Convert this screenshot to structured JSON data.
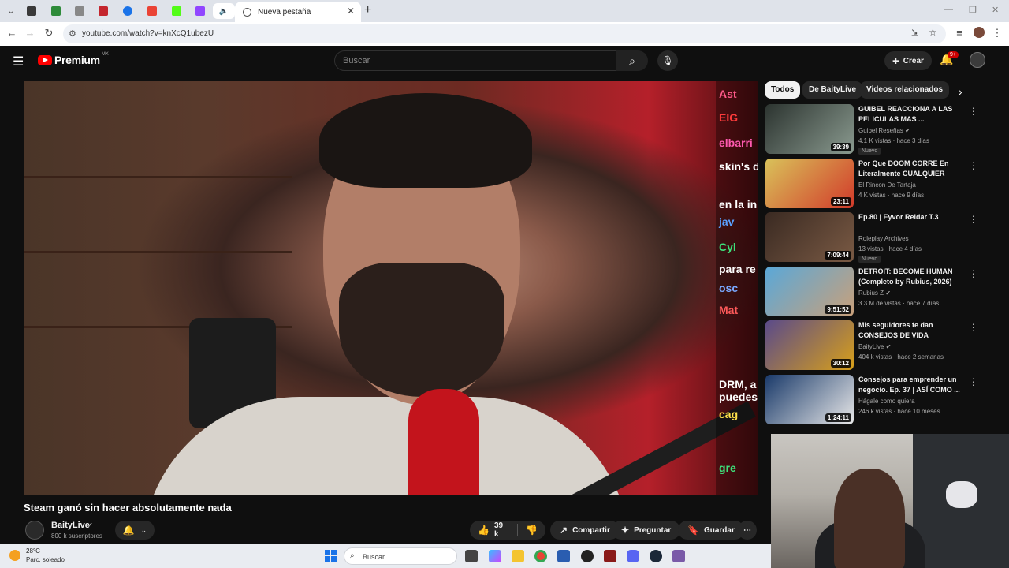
{
  "browser": {
    "tab_title": "Nueva pestaña",
    "url": "youtube.com/watch?v=knXcQ1ubezU"
  },
  "youtube": {
    "logo_text": "Premium",
    "country_code": "MX",
    "search_placeholder": "Buscar",
    "create_label": "Crear",
    "notifications_badge": "9+"
  },
  "video": {
    "title": "Steam ganó sin hacer absolutamente nada",
    "channel_name": "BaityLive",
    "subscribers": "800 k suscriptores",
    "like_count": "39 k",
    "share_label": "Compartir",
    "ask_label": "Preguntar",
    "save_label": "Guardar"
  },
  "chat_overlay": [
    {
      "text": "Ast",
      "color": "#ff5a8a"
    },
    {
      "text": "EIG",
      "color": "#ff3b3b"
    },
    {
      "text": "elbarri",
      "color": "#ff5ab0"
    },
    {
      "text": "skin's d",
      "color": "#ffffff"
    },
    {
      "text": "en la in",
      "color": "#ffffff"
    },
    {
      "text": "jav",
      "color": "#5aa0ff"
    },
    {
      "text": "Cyl",
      "color": "#3ee07a"
    },
    {
      "text": "para re",
      "color": "#ffffff"
    },
    {
      "text": "osc",
      "color": "#7aa8ff"
    },
    {
      "text": "Mat",
      "color": "#ff5a5a"
    },
    {
      "text": "DRM, a",
      "color": "#ffffff"
    },
    {
      "text": "puedes",
      "color": "#ffffff"
    },
    {
      "text": "cag",
      "color": "#ffe34a"
    },
    {
      "text": "gre",
      "color": "#3ee07a"
    }
  ],
  "sidebar": {
    "chips": [
      "Todos",
      "De BaityLive",
      "Videos relacionados"
    ],
    "recommendations": [
      {
        "title": "GUIBEL REACCIONA A LAS PELICULAS MAS ...",
        "channel": "Guibel Reseñas",
        "verified": true,
        "meta": "4.1 K vistas · hace 3 días",
        "duration": "39:39",
        "badge": "Nuevo",
        "thumb": [
          "#2c3430",
          "#8a9a8f"
        ]
      },
      {
        "title": "Por Que DOOM CORRE En Literalmente CUALQUIER COS...",
        "channel": "El Rincon De Tartaja",
        "verified": false,
        "meta": "4 K vistas · hace 9 días",
        "duration": "23:11",
        "badge": "",
        "thumb": [
          "#d9c25a",
          "#d23a2a"
        ]
      },
      {
        "title": "Ep.80 | Eyvor Reidar T.3",
        "channel": "Roleplay Archives",
        "verified": false,
        "meta": "13 vistas · hace 4 días",
        "duration": "7:09:44",
        "badge": "Nuevo",
        "thumb": [
          "#3a2a22",
          "#7a5a44"
        ]
      },
      {
        "title": "DETROIT: BECOME HUMAN (Completo by Rubius, 2026)",
        "channel": "Rubius Z",
        "verified": true,
        "meta": "3.3 M de vistas · hace 7 días",
        "duration": "9:51:52",
        "badge": "",
        "thumb": [
          "#5aa8d8",
          "#c9a07a"
        ]
      },
      {
        "title": "Mis seguidores te dan CONSEJOS DE VIDA",
        "channel": "BaityLive",
        "verified": true,
        "meta": "404 k vistas · hace 2 semanas",
        "duration": "30:12",
        "badge": "",
        "thumb": [
          "#5a4a8a",
          "#d8a01a"
        ]
      },
      {
        "title": "Consejos para emprender un negocio. Ep. 37 | ASÍ COMO ...",
        "channel": "Hágale como quiera",
        "verified": false,
        "meta": "246 k vistas · hace 10 meses",
        "duration": "1:24:11",
        "badge": "",
        "thumb": [
          "#1a3a6a",
          "#e8e8e8"
        ]
      }
    ]
  },
  "taskbar": {
    "temp": "28°C",
    "weather": "Parc. soleado",
    "search_label": "Buscar"
  }
}
